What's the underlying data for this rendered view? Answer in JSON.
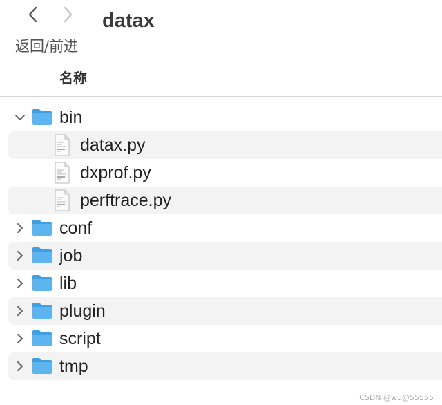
{
  "window": {
    "title": "datax"
  },
  "toolbar": {
    "back_icon": "chevron-left-icon",
    "forward_icon": "chevron-right-icon",
    "nav_label": "返回/前进"
  },
  "columns": {
    "name_header": "名称"
  },
  "items": [
    {
      "name": "bin",
      "type": "folder",
      "expanded": true
    },
    {
      "name": "datax.py",
      "type": "file"
    },
    {
      "name": "dxprof.py",
      "type": "file"
    },
    {
      "name": "perftrace.py",
      "type": "file"
    },
    {
      "name": "conf",
      "type": "folder",
      "expanded": false
    },
    {
      "name": "job",
      "type": "folder",
      "expanded": false
    },
    {
      "name": "lib",
      "type": "folder",
      "expanded": false
    },
    {
      "name": "plugin",
      "type": "folder",
      "expanded": false
    },
    {
      "name": "script",
      "type": "folder",
      "expanded": false
    },
    {
      "name": "tmp",
      "type": "folder",
      "expanded": false
    }
  ],
  "colors": {
    "folder_blue": "#5eb4ee",
    "folder_dark": "#3f9fe0",
    "row_stripe": "#f3f3f3"
  },
  "watermark": "CSDN @wu@55555"
}
